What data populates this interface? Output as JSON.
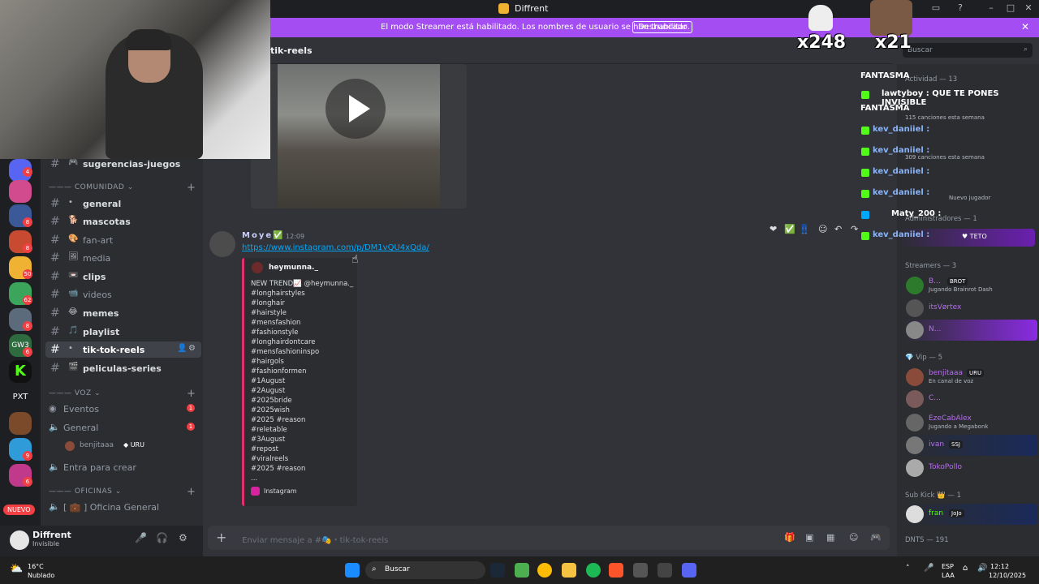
{
  "window": {
    "title": "Diffrent"
  },
  "banner": {
    "message": "El modo Streamer está habilitado. Los nombres de usuario se han truncado.",
    "button": "Deshabilitar"
  },
  "channel_header": {
    "name": "tik-reels"
  },
  "search": {
    "placeholder": "Buscar"
  },
  "channels": {
    "top": "sugerencias-juegos",
    "category_comunidad": "——— COMUNIDAD",
    "items": [
      {
        "name": "general",
        "emoji": "•"
      },
      {
        "name": "mascotas",
        "emoji": "🐕"
      },
      {
        "name": "fan-art",
        "emoji": "🎨"
      },
      {
        "name": "media",
        "emoji": "🖼"
      },
      {
        "name": "clips",
        "emoji": "📼"
      },
      {
        "name": "videos",
        "emoji": "📹"
      },
      {
        "name": "memes",
        "emoji": "😂"
      },
      {
        "name": "playlist",
        "emoji": "🎵"
      },
      {
        "name": "tik-tok-reels",
        "emoji": "•"
      },
      {
        "name": "peliculas-series",
        "emoji": "🎬"
      }
    ],
    "category_voz": "——— VOZ",
    "voice": [
      {
        "name": "Eventos",
        "badge": "1"
      },
      {
        "name": "General",
        "badge": "1"
      }
    ],
    "voice_user": "benjitaaa",
    "voice_user_tag": "URU",
    "create": "Entra para crear",
    "category_oficinas": "——— OFICINAS",
    "office": "[ 💼 ] Oficina General"
  },
  "servers": {
    "badges": [
      "4",
      "8",
      "8",
      "6",
      "50",
      "62",
      "8",
      "6",
      "9",
      "6"
    ],
    "label_pxt": "PXT",
    "label_gw": "GW3",
    "nuevo": "NUEVO"
  },
  "user_panel": {
    "name": "Diffrent",
    "status": "Invisible"
  },
  "message": {
    "author": "Moye",
    "time": "12:09",
    "link": "https://www.instagram.com/p/DM1vQU4xQda/",
    "embed_author": "heymunna._",
    "embed_desc": "NEW TREND📈 @heymunna._\n#longhairstyles\n#longhair\n#hairstyle\n#mensfashion\n#fashionstyle\n#longhairdontcare\n#mensfashioninspo\n#hairgols\n#fashionformen\n#1August\n#2August\n#2025bride\n#2025wish\n#2025 #reason\n#reletable\n#3August\n#repost\n#viralreels\n#2025 #reason\n...",
    "embed_footer": "Instagram"
  },
  "composer": {
    "placeholder": "Enviar mensaje a #🎭・tik-tok-reels"
  },
  "members": {
    "activity_header": "Actividad — 13",
    "admins_header": "Administradores — 1",
    "streamers_header": "Streamers — 3",
    "streamers": [
      {
        "name": "B...",
        "tag": "BROT",
        "status": "Jugando Brainrot Dash"
      },
      {
        "name": "itsVørtex"
      },
      {
        "name": "N..."
      }
    ],
    "vip_header": "Vip — 5",
    "vips": [
      {
        "name": "benjitaaa",
        "tag": "URU",
        "status": "En canal de voz"
      },
      {
        "name": "C..."
      },
      {
        "name": "EzeCabAlex",
        "status": "Jugando a Megabonk"
      },
      {
        "name": "ivan",
        "tag": "SSJ"
      },
      {
        "name": "TokoPollo"
      }
    ],
    "subkick_header": "Sub Kick 👑 — 1",
    "subkick": [
      {
        "name": "fran",
        "tag": "JoJo"
      }
    ],
    "dnts_header": "DNTS — 191",
    "activity_lines": [
      "115 canciones esta semana",
      "309 canciones esta semana",
      "Nuevo jugador"
    ],
    "teto": "TETO"
  },
  "overlay_chat": [
    {
      "user": "FANTASMA"
    },
    {
      "user": "lawtyboy",
      "text": ": QUE TE PONES INVISIBLE"
    },
    {
      "user": "FANTASMA"
    },
    {
      "user": "kev_daniiel",
      "text": ":"
    },
    {
      "user": "kev_daniiel",
      "text": ":"
    },
    {
      "user": "kev_daniiel",
      "text": ":"
    },
    {
      "user": "kev_daniiel",
      "text": ":"
    },
    {
      "user": "Maty_200",
      "text": ":"
    },
    {
      "user": "kev_daniiel",
      "text": ":"
    }
  ],
  "overlay_counts": {
    "duck": "x248",
    "face": "x21"
  },
  "taskbar": {
    "temp": "16°C",
    "weather": "Nublado",
    "search": "Buscar",
    "lang": "ESP",
    "lang2": "LAA",
    "time": "12:12",
    "date": "12/10/2025"
  },
  "colors": {
    "accent": "#a44df2",
    "link": "#00a8fc",
    "kick": "#53fc18"
  }
}
